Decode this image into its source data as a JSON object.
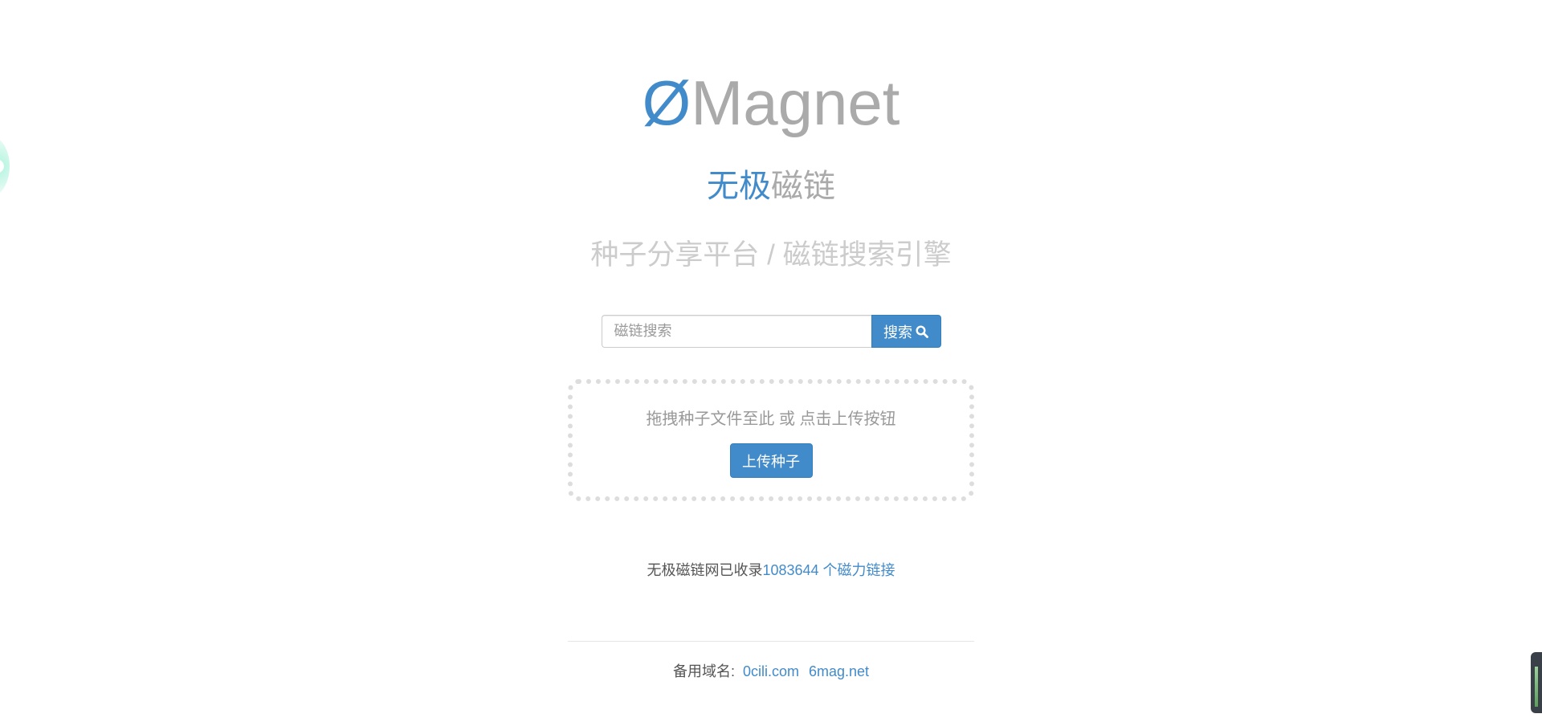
{
  "logo": {
    "mark": "Ø",
    "text": "Magnet"
  },
  "subtitle": {
    "blue": "无极",
    "gray": "磁链"
  },
  "slogan": "种子分享平台 / 磁链搜索引擎",
  "search": {
    "placeholder": "磁链搜索",
    "value": "",
    "button_label": "搜索",
    "icon": "search-icon"
  },
  "upload": {
    "hint": "拖拽种子文件至此 或 点击上传按钮",
    "button_label": "上传种子"
  },
  "stats": {
    "prefix": "无极磁链网已收录 ",
    "link": "1083644 个磁力链接"
  },
  "footer": {
    "label": "备用域名:",
    "domains": [
      "0cili.com",
      "6mag.net"
    ]
  },
  "colors": {
    "accent": "#428bca",
    "logo_gray": "#aaaaaa",
    "slogan_gray": "#cccccc",
    "dropzone_border": "#dddddd"
  }
}
